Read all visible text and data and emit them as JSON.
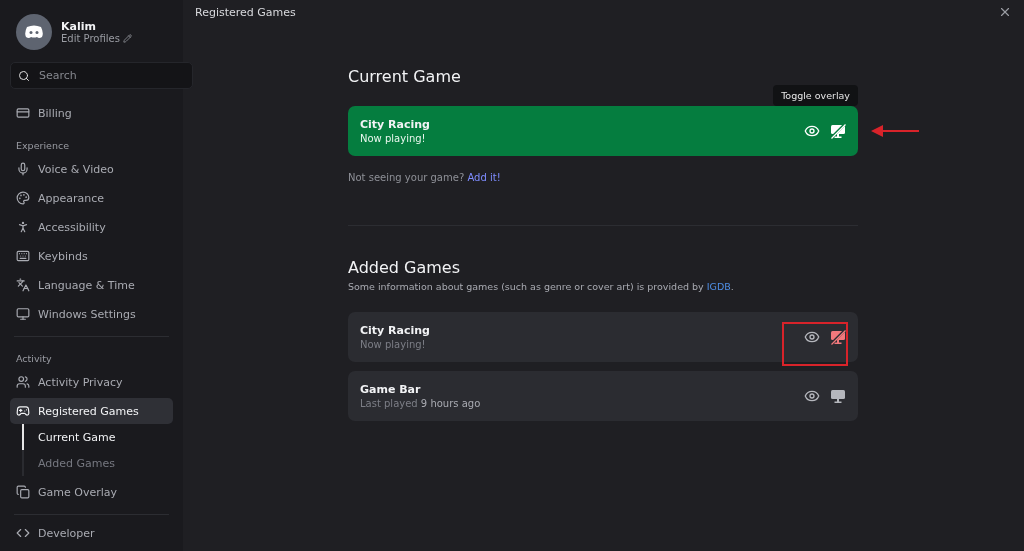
{
  "profile": {
    "name": "Kalim",
    "subtitle": "Edit Profiles"
  },
  "search": {
    "placeholder": "Search"
  },
  "sidebar": [
    {
      "kind": "item",
      "label": "Billing",
      "selected": false
    },
    {
      "kind": "header",
      "label": "Experience"
    },
    {
      "kind": "item",
      "label": "Voice & Video",
      "selected": false
    },
    {
      "kind": "item",
      "label": "Appearance",
      "selected": false
    },
    {
      "kind": "item",
      "label": "Accessibility",
      "selected": false
    },
    {
      "kind": "item",
      "label": "Keybinds",
      "selected": false
    },
    {
      "kind": "item",
      "label": "Language & Time",
      "selected": false
    },
    {
      "kind": "item",
      "label": "Windows Settings",
      "selected": false
    },
    {
      "kind": "divider"
    },
    {
      "kind": "header",
      "label": "Activity"
    },
    {
      "kind": "item",
      "label": "Activity Privacy",
      "selected": false
    },
    {
      "kind": "item",
      "label": "Registered Games",
      "selected": true
    },
    {
      "kind": "subitem",
      "label": "Current Game",
      "selected": true
    },
    {
      "kind": "subitem",
      "label": "Added Games",
      "selected": false
    },
    {
      "kind": "item",
      "label": "Game Overlay",
      "selected": false
    },
    {
      "kind": "divider"
    },
    {
      "kind": "item",
      "label": "Developer",
      "selected": false
    }
  ],
  "page_title": "Registered Games",
  "current_game": {
    "heading": "Current Game",
    "name": "City Racing",
    "status": "Now playing!",
    "overlay": false,
    "tooltip": "Toggle overlay",
    "annotated": true,
    "note": "Not seeing your game?",
    "link": "Add it!"
  },
  "added_games": {
    "heading": "Added Games",
    "info": "Some information about games (such as genre or cover art) is provided by",
    "info_link": "IGDB",
    "info_end": ".",
    "games": [
      {
        "name": "City Racing",
        "status": "Now playing!",
        "overlay": false,
        "hover": true,
        "annotated": true
      },
      {
        "name": "Game Bar",
        "status": "Last played **9 hours ago**",
        "overlay": true,
        "hover": false,
        "annotated": false
      }
    ]
  }
}
